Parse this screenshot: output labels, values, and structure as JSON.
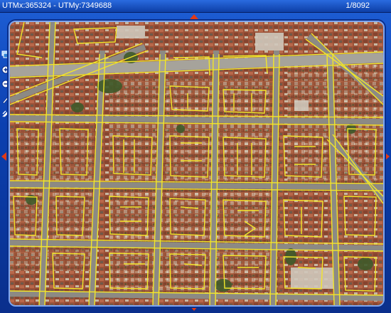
{
  "header": {
    "coords": "UTMx:365324 - UTMy:7349688",
    "counter": "1/8092"
  },
  "tools": [
    {
      "name": "layers-icon"
    },
    {
      "name": "zoom-in-icon"
    },
    {
      "name": "zoom-out-icon"
    },
    {
      "name": "pencil-icon"
    },
    {
      "name": "measure-icon"
    }
  ],
  "colors": {
    "frame": "#0a3fa8",
    "arrow": "#e23a16",
    "street_lines": "#f2e62a",
    "roofs": "#a3553a",
    "roads": "#8c8a84",
    "trees": "#3f5a2a"
  }
}
